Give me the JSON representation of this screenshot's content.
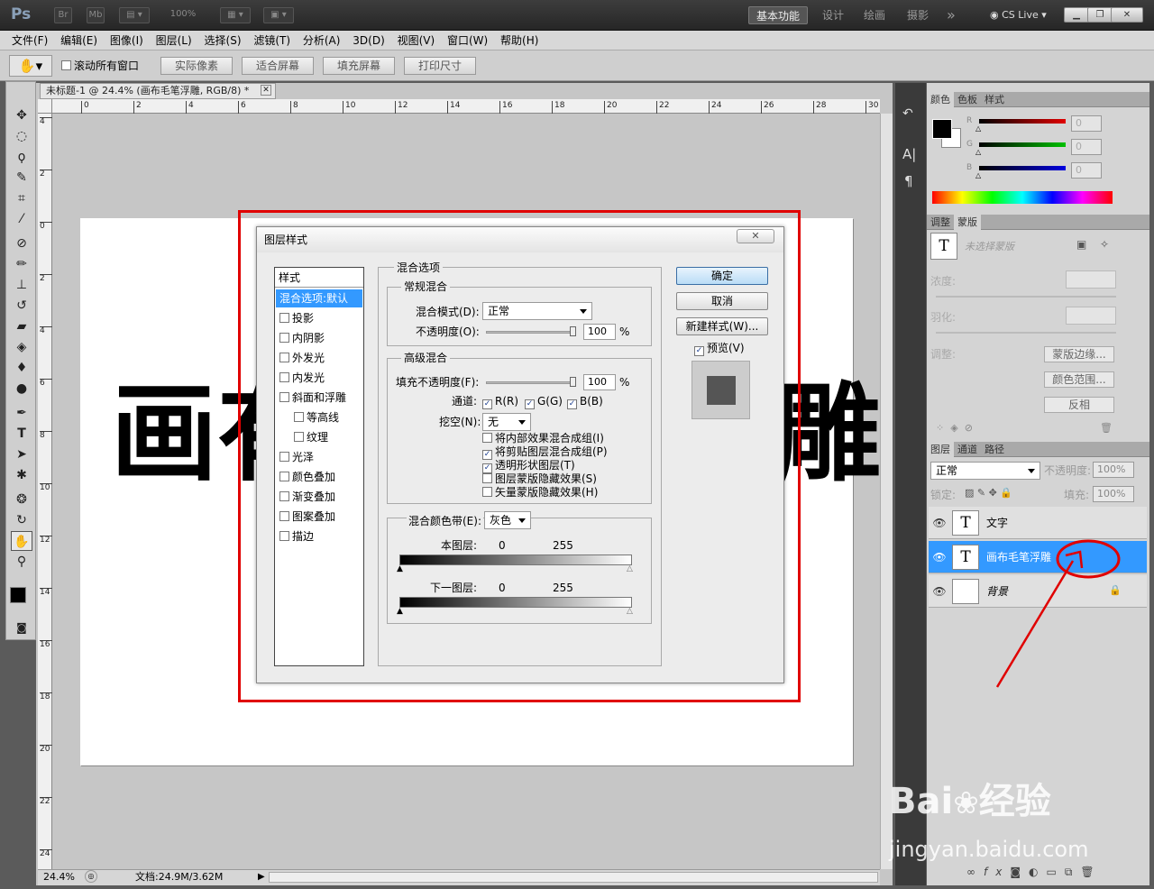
{
  "app": {
    "logo": "Ps",
    "bridge": "Br",
    "minibridge": "Mb",
    "zoom_display": "100%",
    "workspaces": [
      "基本功能",
      "设计",
      "绘画",
      "摄影"
    ],
    "more": "»",
    "cslive": "CS Live"
  },
  "menu": [
    "文件(F)",
    "编辑(E)",
    "图像(I)",
    "图层(L)",
    "选择(S)",
    "滤镜(T)",
    "分析(A)",
    "3D(D)",
    "视图(V)",
    "窗口(W)",
    "帮助(H)"
  ],
  "options": {
    "scroll_all": "滚动所有窗口",
    "buttons": [
      "实际像素",
      "适合屏幕",
      "填充屏幕",
      "打印尺寸"
    ]
  },
  "document": {
    "tab_title": "未标题-1 @ 24.4% (画布毛笔浮雕, RGB/8) *",
    "canvas_text_left": "画有",
    "canvas_text_right": "雕",
    "ruler_h": [
      "0",
      "2",
      "4",
      "6",
      "8",
      "10",
      "12",
      "14",
      "16",
      "18",
      "20",
      "22",
      "24",
      "26",
      "28",
      "30"
    ],
    "ruler_v": [
      "4",
      "2",
      "0",
      "2",
      "4",
      "6",
      "8",
      "10",
      "12",
      "14",
      "16",
      "18",
      "20",
      "22",
      "24"
    ]
  },
  "status": {
    "zoom": "24.4%",
    "doc": "文档:24.9M/3.62M"
  },
  "dialog": {
    "title": "图层样式",
    "close": "✕",
    "styles_header": "样式",
    "styles": [
      {
        "label": "混合选项:默认",
        "checkbox": false,
        "selected": true
      },
      {
        "label": "投影",
        "checkbox": true
      },
      {
        "label": "内阴影",
        "checkbox": true
      },
      {
        "label": "外发光",
        "checkbox": true
      },
      {
        "label": "内发光",
        "checkbox": true
      },
      {
        "label": "斜面和浮雕",
        "checkbox": true
      },
      {
        "label": "等高线",
        "checkbox": true,
        "indent": true
      },
      {
        "label": "纹理",
        "checkbox": true,
        "indent": true
      },
      {
        "label": "光泽",
        "checkbox": true
      },
      {
        "label": "颜色叠加",
        "checkbox": true
      },
      {
        "label": "渐变叠加",
        "checkbox": true
      },
      {
        "label": "图案叠加",
        "checkbox": true
      },
      {
        "label": "描边",
        "checkbox": true
      }
    ],
    "blend_options": "混合选项",
    "general": {
      "title": "常规混合",
      "mode_label": "混合模式(D):",
      "mode_value": "正常",
      "opacity_label": "不透明度(O):",
      "opacity_value": "100",
      "pct": "%"
    },
    "advanced": {
      "title": "高级混合",
      "fill_label": "填充不透明度(F):",
      "fill_value": "100",
      "pct": "%",
      "channels_label": "通道:",
      "channels": [
        "R(R)",
        "G(G)",
        "B(B)"
      ],
      "knockout_label": "挖空(N):",
      "knockout_value": "无",
      "options": [
        {
          "label": "将内部效果混合成组(I)",
          "checked": false
        },
        {
          "label": "将剪贴图层混合成组(P)",
          "checked": true
        },
        {
          "label": "透明形状图层(T)",
          "checked": true
        },
        {
          "label": "图层蒙版隐藏效果(S)",
          "checked": false
        },
        {
          "label": "矢量蒙版隐藏效果(H)",
          "checked": false
        }
      ]
    },
    "blend_if": {
      "label": "混合颜色带(E):",
      "value": "灰色",
      "this_layer": "本图层:",
      "under_layer": "下一图层:",
      "min": "0",
      "max": "255"
    },
    "buttons": {
      "ok": "确定",
      "cancel": "取消",
      "new_style": "新建样式(W)...",
      "preview": "预览(V)"
    },
    "check_mark": "✓"
  },
  "panels": {
    "color_tabs": [
      "颜色",
      "色板",
      "样式"
    ],
    "channels": [
      {
        "label": "R",
        "value": "0",
        "color": "#e00000"
      },
      {
        "label": "G",
        "value": "0",
        "color": "#00c000"
      },
      {
        "label": "B",
        "value": "0",
        "color": "#0000e0"
      }
    ],
    "adjust_tabs": [
      "调整",
      "蒙版"
    ],
    "mask": {
      "none": "未选择蒙版",
      "density": "浓度:",
      "feather": "羽化:",
      "refine": "调整:",
      "buttons": [
        "蒙版边缘...",
        "颜色范围...",
        "反相"
      ]
    },
    "layers_tabs": [
      "图层",
      "通道",
      "路径"
    ],
    "layers": {
      "blend_mode": "正常",
      "opacity_label": "不透明度:",
      "opacity_value": "100%",
      "lock_label": "锁定:",
      "fill_label": "填充:",
      "fill_value": "100%",
      "items": [
        {
          "name": "文字",
          "thumb": "T",
          "selected": false
        },
        {
          "name": "画布毛笔浮雕",
          "thumb": "T",
          "selected": true
        },
        {
          "name": "背景",
          "thumb": "",
          "selected": false,
          "locked": true
        }
      ]
    }
  },
  "watermark": {
    "brand": "Bai",
    "brand2": "经验",
    "url": "jingyan.baidu.com"
  },
  "colors": {
    "annotation_red": "#e00000",
    "selection_blue": "#3399ff"
  }
}
